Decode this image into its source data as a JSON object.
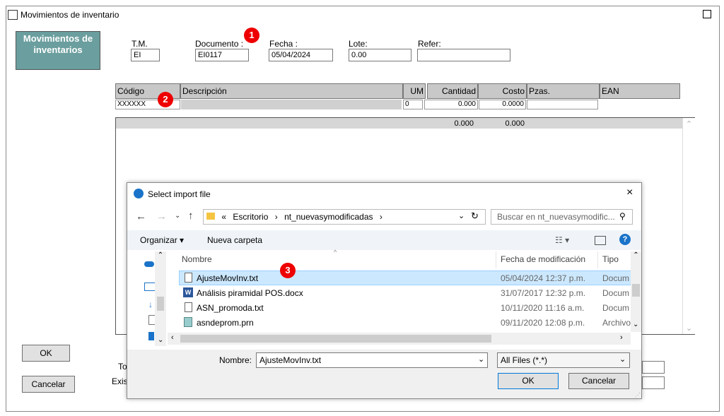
{
  "window": {
    "title": "Movimientos de inventario"
  },
  "badge": {
    "text": "Movimientos de inventarios"
  },
  "fields": {
    "tm_label": "T.M.",
    "tm_value": "EI",
    "doc_label": "Documento :",
    "doc_value": "EI0117",
    "fecha_label": "Fecha :",
    "fecha_value": "05/04/2024",
    "lote_label": "Lote:",
    "lote_value": "0.00",
    "refer_label": "Refer:",
    "refer_value": ""
  },
  "markers": [
    "1",
    "2",
    "3"
  ],
  "grid": {
    "headers": [
      "Código",
      "Descripción",
      "UM",
      "Cantidad",
      "Costo",
      "Pzas.",
      "EAN"
    ],
    "entry": {
      "codigo": "XXXXXX",
      "um": "0",
      "cantidad": "0.000",
      "costo": "0.0000"
    },
    "totals": {
      "cantidad": "0.000",
      "costo": "0.000"
    }
  },
  "buttons": {
    "ok": "OK",
    "cancel": "Cancelar"
  },
  "partial_labels": {
    "to": "To",
    "exis": "Exist"
  },
  "dialog": {
    "title": "Select import file",
    "path": [
      "«",
      "Escritorio",
      "›",
      "nt_nuevasymodificadas",
      "›"
    ],
    "search_placeholder": "Buscar en nt_nuevasymodific...",
    "toolbar": {
      "organize": "Organizar ▾",
      "new_folder": "Nueva carpeta"
    },
    "columns": {
      "name": "Nombre",
      "date": "Fecha de modificación",
      "type": "Tipo"
    },
    "files": [
      {
        "name": "AjusteMovInv.txt",
        "date": "05/04/2024 12:37 p.m.",
        "type": "Docum",
        "icon": "text-file-icon"
      },
      {
        "name": "Análisis piramidal POS.docx",
        "date": "31/07/2017 12:32 p.m.",
        "type": "Docum",
        "icon": "word-file-icon"
      },
      {
        "name": "ASN_promoda.txt",
        "date": "10/11/2020 11:16 a.m.",
        "type": "Docum",
        "icon": "text-file-icon"
      },
      {
        "name": "asndeprom.prn",
        "date": "09/11/2020 12:08 p.m.",
        "type": "Archivo",
        "icon": "prn-file-icon"
      }
    ],
    "filename_label": "Nombre:",
    "filename_value": "AjusteMovInv.txt",
    "filter_value": "All Files (*.*)",
    "ok": "OK",
    "cancel": "Cancelar"
  },
  "colors": {
    "badge": "#6b9e9e",
    "marker": "#e00000",
    "selected_row": "#cce8ff",
    "help": "#1a73c9"
  }
}
